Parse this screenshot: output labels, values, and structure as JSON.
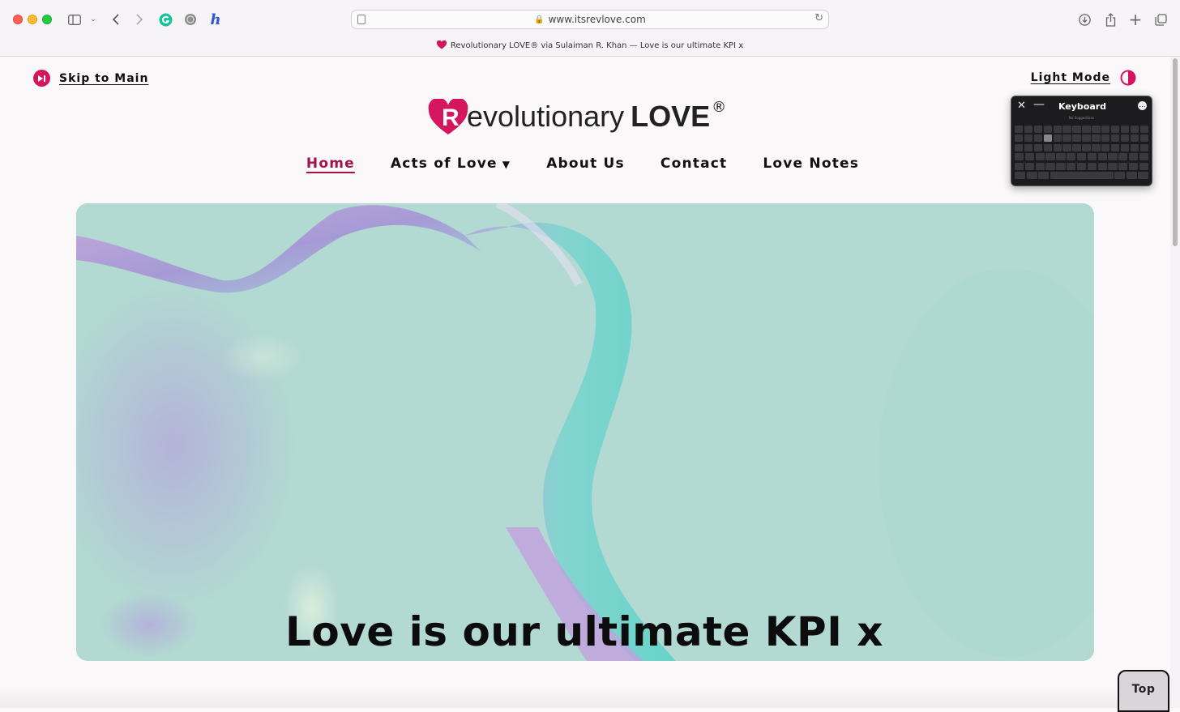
{
  "browser": {
    "url": "www.itsrevlove.com",
    "tab_title": "Revolutionary LOVE® via Sulaiman R. Khan — Love is our ultimate KPI x",
    "icons": [
      "sidebar-icon",
      "chevron-down-icon",
      "back-icon",
      "forward-icon",
      "grammarly-icon",
      "globe-extension-icon",
      "honey-extension-icon",
      "download-icon",
      "share-icon",
      "new-tab-icon",
      "tab-overview-icon"
    ]
  },
  "header": {
    "skip_label": "Skip to Main",
    "light_mode_label": "Light Mode",
    "logo_initial": "R",
    "logo_word": "evolutionary",
    "logo_love": "LOVE",
    "logo_reg": "®"
  },
  "nav": {
    "items": [
      {
        "label": "Home",
        "active": true
      },
      {
        "label": "Acts of Love",
        "has_dropdown": true
      },
      {
        "label": "About Us"
      },
      {
        "label": "Contact"
      },
      {
        "label": "Love Notes"
      }
    ],
    "caret": "▼"
  },
  "hero": {
    "title": "Love is our ultimate KPI x"
  },
  "keyboard": {
    "title": "Keyboard",
    "suggestions": "No Suggestions"
  },
  "top_button": {
    "label": "Top"
  },
  "colors": {
    "accent": "#d6155f",
    "active_nav": "#a3124d",
    "hero_bg": "#b2d9d2"
  }
}
